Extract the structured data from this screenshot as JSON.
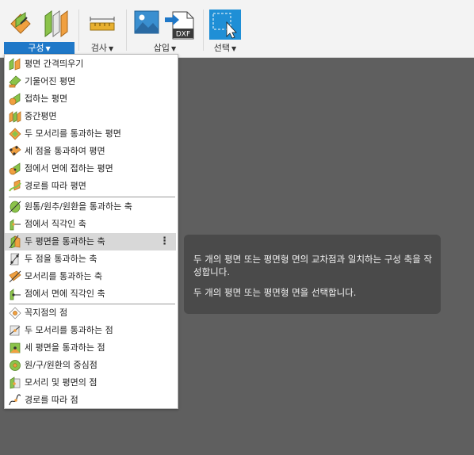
{
  "toolbar": {
    "groups": [
      {
        "label": "구성",
        "active": true
      },
      {
        "label": "검사",
        "active": false
      },
      {
        "label": "삽입",
        "active": false
      },
      {
        "label": "선택",
        "active": false
      }
    ],
    "dxf_text": "DXF"
  },
  "menu": {
    "items": [
      {
        "label": "평면 간격띄우기"
      },
      {
        "label": "기울어진 평면"
      },
      {
        "label": "접하는 평면"
      },
      {
        "label": "중간평면"
      },
      {
        "label": "두 모서리를 통과하는 평면"
      },
      {
        "label": "세 점을 통과하여 평면"
      },
      {
        "label": "점에서 면에 접하는 평면"
      },
      {
        "label": "경로를 따라 평면"
      },
      {
        "label": "원통/원추/원환을 통과하는 축"
      },
      {
        "label": "점에서 직각인 축"
      },
      {
        "label": "두 평면을 통과하는 축",
        "highlighted": true
      },
      {
        "label": "두 점을 통과하는 축"
      },
      {
        "label": "모서리를 통과하는 축"
      },
      {
        "label": "점에서 면에 직각인 축"
      },
      {
        "label": "꼭지점의 점"
      },
      {
        "label": "두 모서리를 통과하는 점"
      },
      {
        "label": "세 평면을 통과하는 점"
      },
      {
        "label": "원/구/원환의 중심점"
      },
      {
        "label": "모서리 및 평면의 점"
      },
      {
        "label": "경로를 따라 점"
      }
    ],
    "more_glyph": "⋮"
  },
  "tooltip": {
    "description": "두 개의 평면 또는 평면형 면의 교차점과 일치하는 구성 축을 작성합니다.",
    "instruction": "두 개의 평면 또는 평면형 면을 선택합니다."
  },
  "colors": {
    "accent": "#1f78c8",
    "canvas": "#5f5f5f",
    "tooltip_bg": "#4a4a4a",
    "plane_green": "#7cb342",
    "plane_orange": "#f0a040"
  }
}
